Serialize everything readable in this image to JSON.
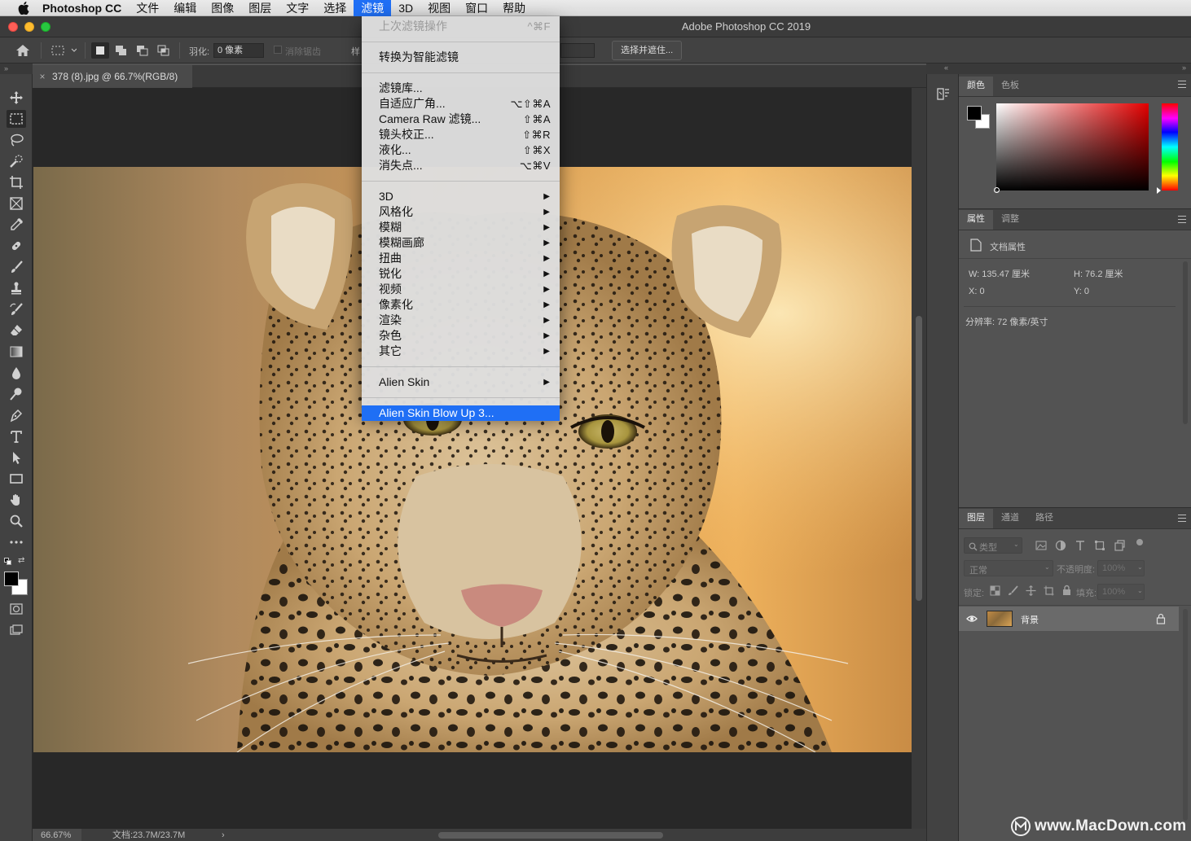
{
  "menubar": {
    "app_name": "Photoshop CC",
    "items": [
      "文件",
      "编辑",
      "图像",
      "图层",
      "文字",
      "选择",
      "滤镜",
      "3D",
      "视图",
      "窗口",
      "帮助"
    ],
    "active_item": "滤镜"
  },
  "window": {
    "title": "Adobe Photoshop CC 2019"
  },
  "options_bar": {
    "feather_label": "羽化:",
    "feather_value": "0 像素",
    "antialias_label": "消除锯齿",
    "style_label_partial": "样",
    "select_mask_button": "选择并遮住..."
  },
  "document": {
    "tab_title": "378 (8).jpg @ 66.7%(RGB/8)",
    "tab_close": "×",
    "zoom": "66.67%",
    "doc_size": "文档:23.7M/23.7M",
    "status_arrow": "›"
  },
  "filter_menu": {
    "items": [
      {
        "label": "上次滤镜操作",
        "shortcut": "^⌘F",
        "disabled": true
      },
      {
        "divider": true
      },
      {
        "label": "转换为智能滤镜"
      },
      {
        "divider": true
      },
      {
        "label": "滤镜库..."
      },
      {
        "label": "自适应广角...",
        "shortcut": "⌥⇧⌘A"
      },
      {
        "label": "Camera Raw 滤镜...",
        "shortcut": "⇧⌘A"
      },
      {
        "label": "镜头校正...",
        "shortcut": "⇧⌘R"
      },
      {
        "label": "液化...",
        "shortcut": "⇧⌘X"
      },
      {
        "label": "消失点...",
        "shortcut": "⌥⌘V"
      },
      {
        "divider": true
      },
      {
        "label": "3D",
        "submenu": true
      },
      {
        "label": "风格化",
        "submenu": true
      },
      {
        "label": "模糊",
        "submenu": true
      },
      {
        "label": "模糊画廊",
        "submenu": true
      },
      {
        "label": "扭曲",
        "submenu": true
      },
      {
        "label": "锐化",
        "submenu": true
      },
      {
        "label": "视频",
        "submenu": true
      },
      {
        "label": "像素化",
        "submenu": true
      },
      {
        "label": "渲染",
        "submenu": true
      },
      {
        "label": "杂色",
        "submenu": true
      },
      {
        "label": "其它",
        "submenu": true
      },
      {
        "divider": true
      },
      {
        "label": "Alien Skin",
        "submenu": true
      },
      {
        "divider": true
      },
      {
        "label": "Alien Skin Blow Up 3...",
        "highlighted": true
      }
    ]
  },
  "color_panel": {
    "tabs": [
      "颜色",
      "色板"
    ],
    "active_tab": "颜色"
  },
  "properties_panel": {
    "tabs": [
      "属性",
      "调整"
    ],
    "active_tab": "属性",
    "section_title": "文档属性",
    "width": "W: 135.47 厘米",
    "height": "H: 76.2 厘米",
    "x": "X: 0",
    "y": "Y: 0",
    "resolution": "分辨率: 72 像素/英寸"
  },
  "layers_panel": {
    "tabs": [
      "图层",
      "通道",
      "路径"
    ],
    "active_tab": "图层",
    "filter_placeholder": "类型",
    "blend_mode": "正常",
    "opacity_label": "不透明度:",
    "opacity_value": "100%",
    "lock_label": "锁定:",
    "fill_label": "填充:",
    "fill_value": "100%",
    "layers": [
      {
        "name": "背景",
        "visible": true,
        "locked": true
      }
    ]
  },
  "watermark": "www.MacDown.com",
  "colors": {
    "accent": "#1f6ff5",
    "panel_bg": "#535353",
    "toolbar_bg": "#424242",
    "canvas_bg": "#282828"
  },
  "tools": [
    "move-icon",
    "marquee-icon",
    "lasso-icon",
    "quick-select-icon",
    "crop-icon",
    "frame-icon",
    "eyedropper-icon",
    "healing-brush-icon",
    "brush-icon",
    "clone-stamp-icon",
    "history-brush-icon",
    "eraser-icon",
    "gradient-icon",
    "blur-icon",
    "dodge-icon",
    "pen-icon",
    "type-icon",
    "path-select-icon",
    "rectangle-icon",
    "hand-icon",
    "zoom-icon",
    "more-tools-icon"
  ]
}
